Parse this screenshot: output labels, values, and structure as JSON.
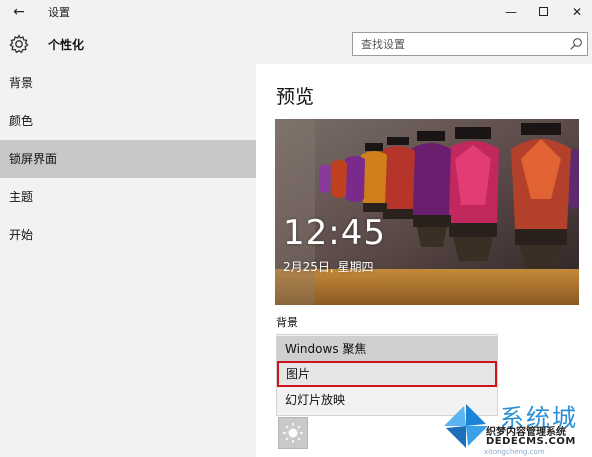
{
  "window": {
    "title": "设置",
    "back_glyph": "←",
    "minimize_glyph": "—",
    "close_glyph": "✕"
  },
  "header": {
    "title": "个性化",
    "icon": "gear-icon",
    "search_placeholder": "查找设置"
  },
  "sidebar": {
    "items": [
      {
        "label": "背景",
        "selected": false
      },
      {
        "label": "颜色",
        "selected": false
      },
      {
        "label": "锁屏界面",
        "selected": true
      },
      {
        "label": "主题",
        "selected": false
      },
      {
        "label": "开始",
        "selected": false
      }
    ]
  },
  "main": {
    "preview_title": "预览",
    "lock_time": "12:45",
    "lock_date": "2月25日, 星期四",
    "background_label": "背景",
    "background_options": [
      {
        "label": "Windows 聚焦",
        "state": "selected"
      },
      {
        "label": "图片",
        "state": "highlighted"
      },
      {
        "label": "幻灯片放映",
        "state": "normal"
      }
    ]
  },
  "watermark": {
    "brand": "系统城",
    "line1": "织梦内容管理系统",
    "line2": "DEDECMS.COM",
    "url": "xitongcheng.com"
  },
  "colors": {
    "sidebar_bg": "#f2f2f2",
    "selected_bg": "#c8c8c8",
    "highlight_border": "#d0141c",
    "brand_blue": "#2b8fd6"
  }
}
